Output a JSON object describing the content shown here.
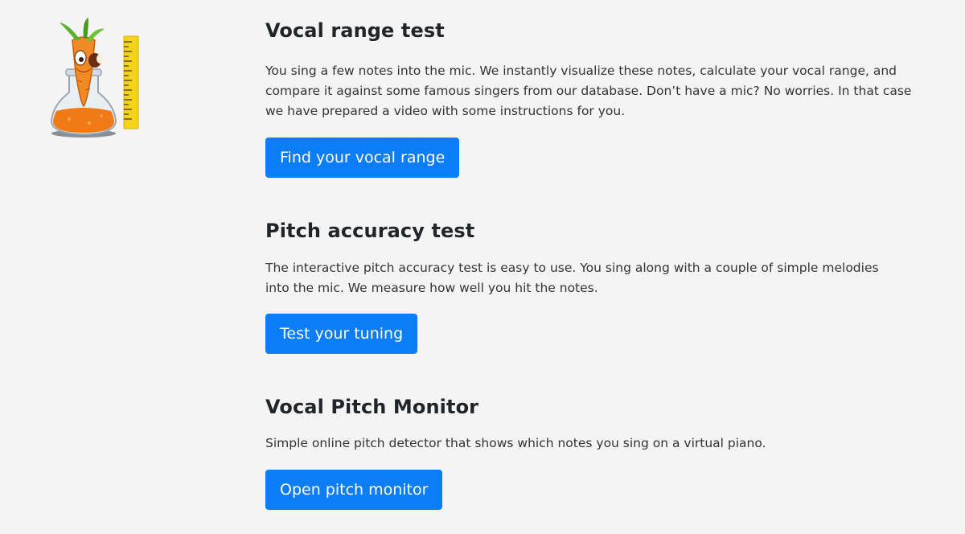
{
  "sections": [
    {
      "title": "Vocal range test",
      "description": "You sing a few notes into the mic. We instantly visualize these notes, calculate your vocal range, and compare it against some famous singers from our database. Don’t have a mic? No worries. In that case we have prepared a video with some instructions for you.",
      "button_label": "Find your vocal range"
    },
    {
      "title": "Pitch accuracy test",
      "description": "The interactive pitch accuracy test is easy to use. You sing along with a couple of simple melodies into the mic. We measure how well you hit the notes.",
      "button_label": "Test your tuning"
    },
    {
      "title": "Vocal Pitch Monitor",
      "description": "Simple online pitch detector that shows which notes you sing on a virtual piano.",
      "button_label": "Open pitch monitor"
    }
  ],
  "colors": {
    "background": "#f4f4f4",
    "button": "#0b7ef7",
    "button_text": "#ffffff",
    "heading": "#212529"
  },
  "icons": {
    "mascot": "carrot-singer-in-flask-with-ruler-illustration"
  }
}
